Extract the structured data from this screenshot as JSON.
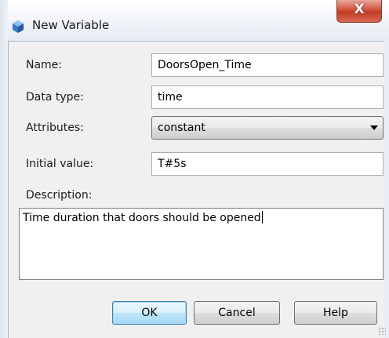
{
  "window": {
    "title": "New Variable",
    "close_label": "X"
  },
  "form": {
    "name_label": "Name:",
    "name_value": "DoorsOpen_Time",
    "datatype_label": "Data type:",
    "datatype_value": "time",
    "attributes_label": "Attributes:",
    "attributes_selected": "constant",
    "initial_label": "Initial value:",
    "initial_value": "T#5s",
    "description_label": "Description:",
    "description_value": "Time duration that doors should be opened"
  },
  "buttons": {
    "ok": "OK",
    "cancel": "Cancel",
    "help": "Help"
  },
  "icons": {
    "title_icon": "variable-cube-icon",
    "dropdown_arrow": "chevron-down-icon"
  },
  "colors": {
    "close_button": "#c23a22",
    "default_button_border": "#3c7fb1",
    "title_icon": "#3b77c4"
  }
}
